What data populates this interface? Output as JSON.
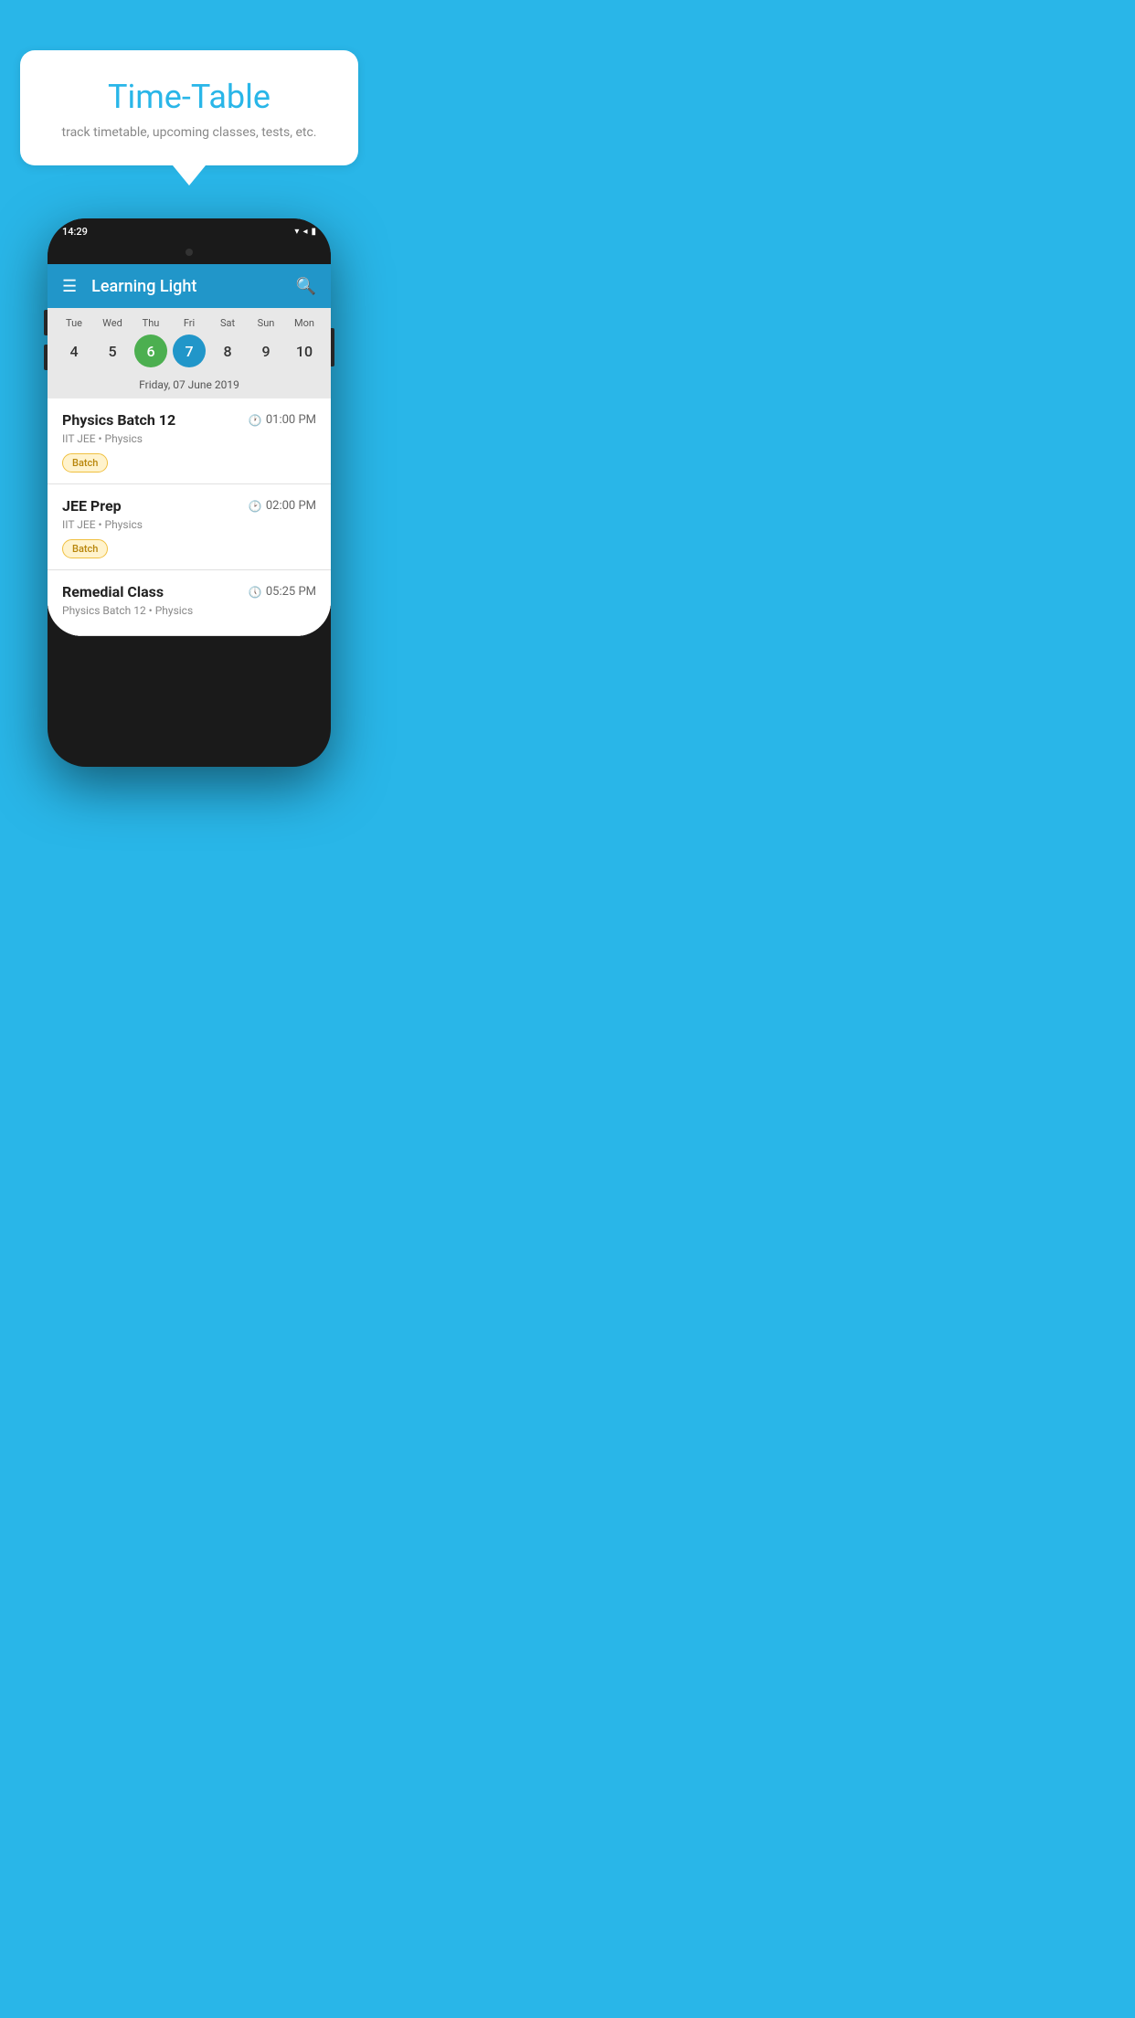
{
  "background": {
    "color": "#29B6E8"
  },
  "speech_bubble": {
    "title": "Time-Table",
    "subtitle": "track timetable, upcoming classes, tests, etc."
  },
  "phone": {
    "status_bar": {
      "time": "14:29",
      "icons": "▾◂▮"
    },
    "app_bar": {
      "title": "Learning Light",
      "menu_icon": "☰",
      "search_icon": "🔍"
    },
    "calendar": {
      "days": [
        {
          "label": "Tue",
          "num": "4",
          "state": "normal"
        },
        {
          "label": "Wed",
          "num": "5",
          "state": "normal"
        },
        {
          "label": "Thu",
          "num": "6",
          "state": "today"
        },
        {
          "label": "Fri",
          "num": "7",
          "state": "selected"
        },
        {
          "label": "Sat",
          "num": "8",
          "state": "normal"
        },
        {
          "label": "Sun",
          "num": "9",
          "state": "normal"
        },
        {
          "label": "Mon",
          "num": "10",
          "state": "normal"
        }
      ],
      "selected_date_label": "Friday, 07 June 2019"
    },
    "schedule": [
      {
        "title": "Physics Batch 12",
        "time": "01:00 PM",
        "sub": "IIT JEE • Physics",
        "tag": "Batch"
      },
      {
        "title": "JEE Prep",
        "time": "02:00 PM",
        "sub": "IIT JEE • Physics",
        "tag": "Batch"
      },
      {
        "title": "Remedial Class",
        "time": "05:25 PM",
        "sub": "Physics Batch 12 • Physics",
        "tag": ""
      }
    ]
  }
}
